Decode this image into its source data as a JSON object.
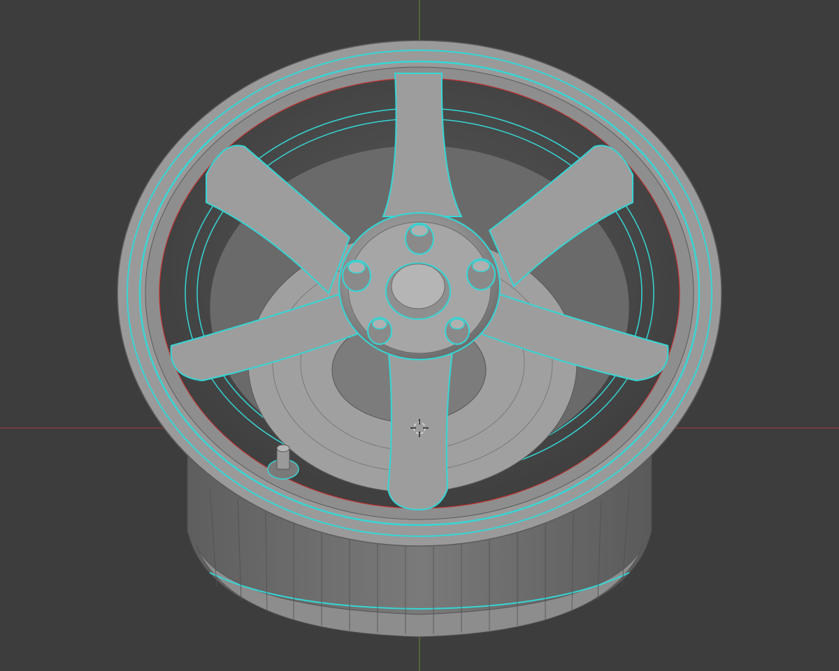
{
  "viewport": {
    "background_color": "#3d3d3d",
    "x_axis_color": "#a23a3a",
    "y_axis_color": "#6b8a2a",
    "mesh_color": "#8a8a8a",
    "edge_color": "#5a5a5a",
    "seam_color": "#36d6d6",
    "sharp_edge_color": "#c03030"
  },
  "scene": {
    "object": "wheel-rim",
    "spoke_count": 6,
    "lug_nut_count": 5,
    "has_valve_stem": true,
    "cursor_icon": "3d-cursor-icon"
  }
}
